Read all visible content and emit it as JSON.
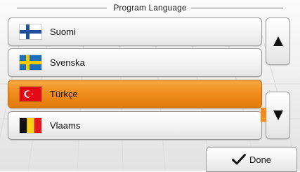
{
  "header": {
    "title": "Program Language"
  },
  "languages": [
    {
      "label": "Suomi",
      "flag": "finland-flag",
      "selected": false
    },
    {
      "label": "Svenska",
      "flag": "sweden-flag",
      "selected": false
    },
    {
      "label": "Türkçe",
      "flag": "turkey-flag",
      "selected": true
    },
    {
      "label": "Vlaams",
      "flag": "belgium-flag",
      "selected": false
    }
  ],
  "scroll": {
    "up_icon": "triangle-up-icon",
    "down_icon": "triangle-down-icon"
  },
  "footer": {
    "done_label": "Done",
    "done_icon": "checkmark-icon"
  },
  "colors": {
    "selected_accent": "#f08d1c",
    "button_border": "#9a9a9a",
    "text": "#111111"
  }
}
